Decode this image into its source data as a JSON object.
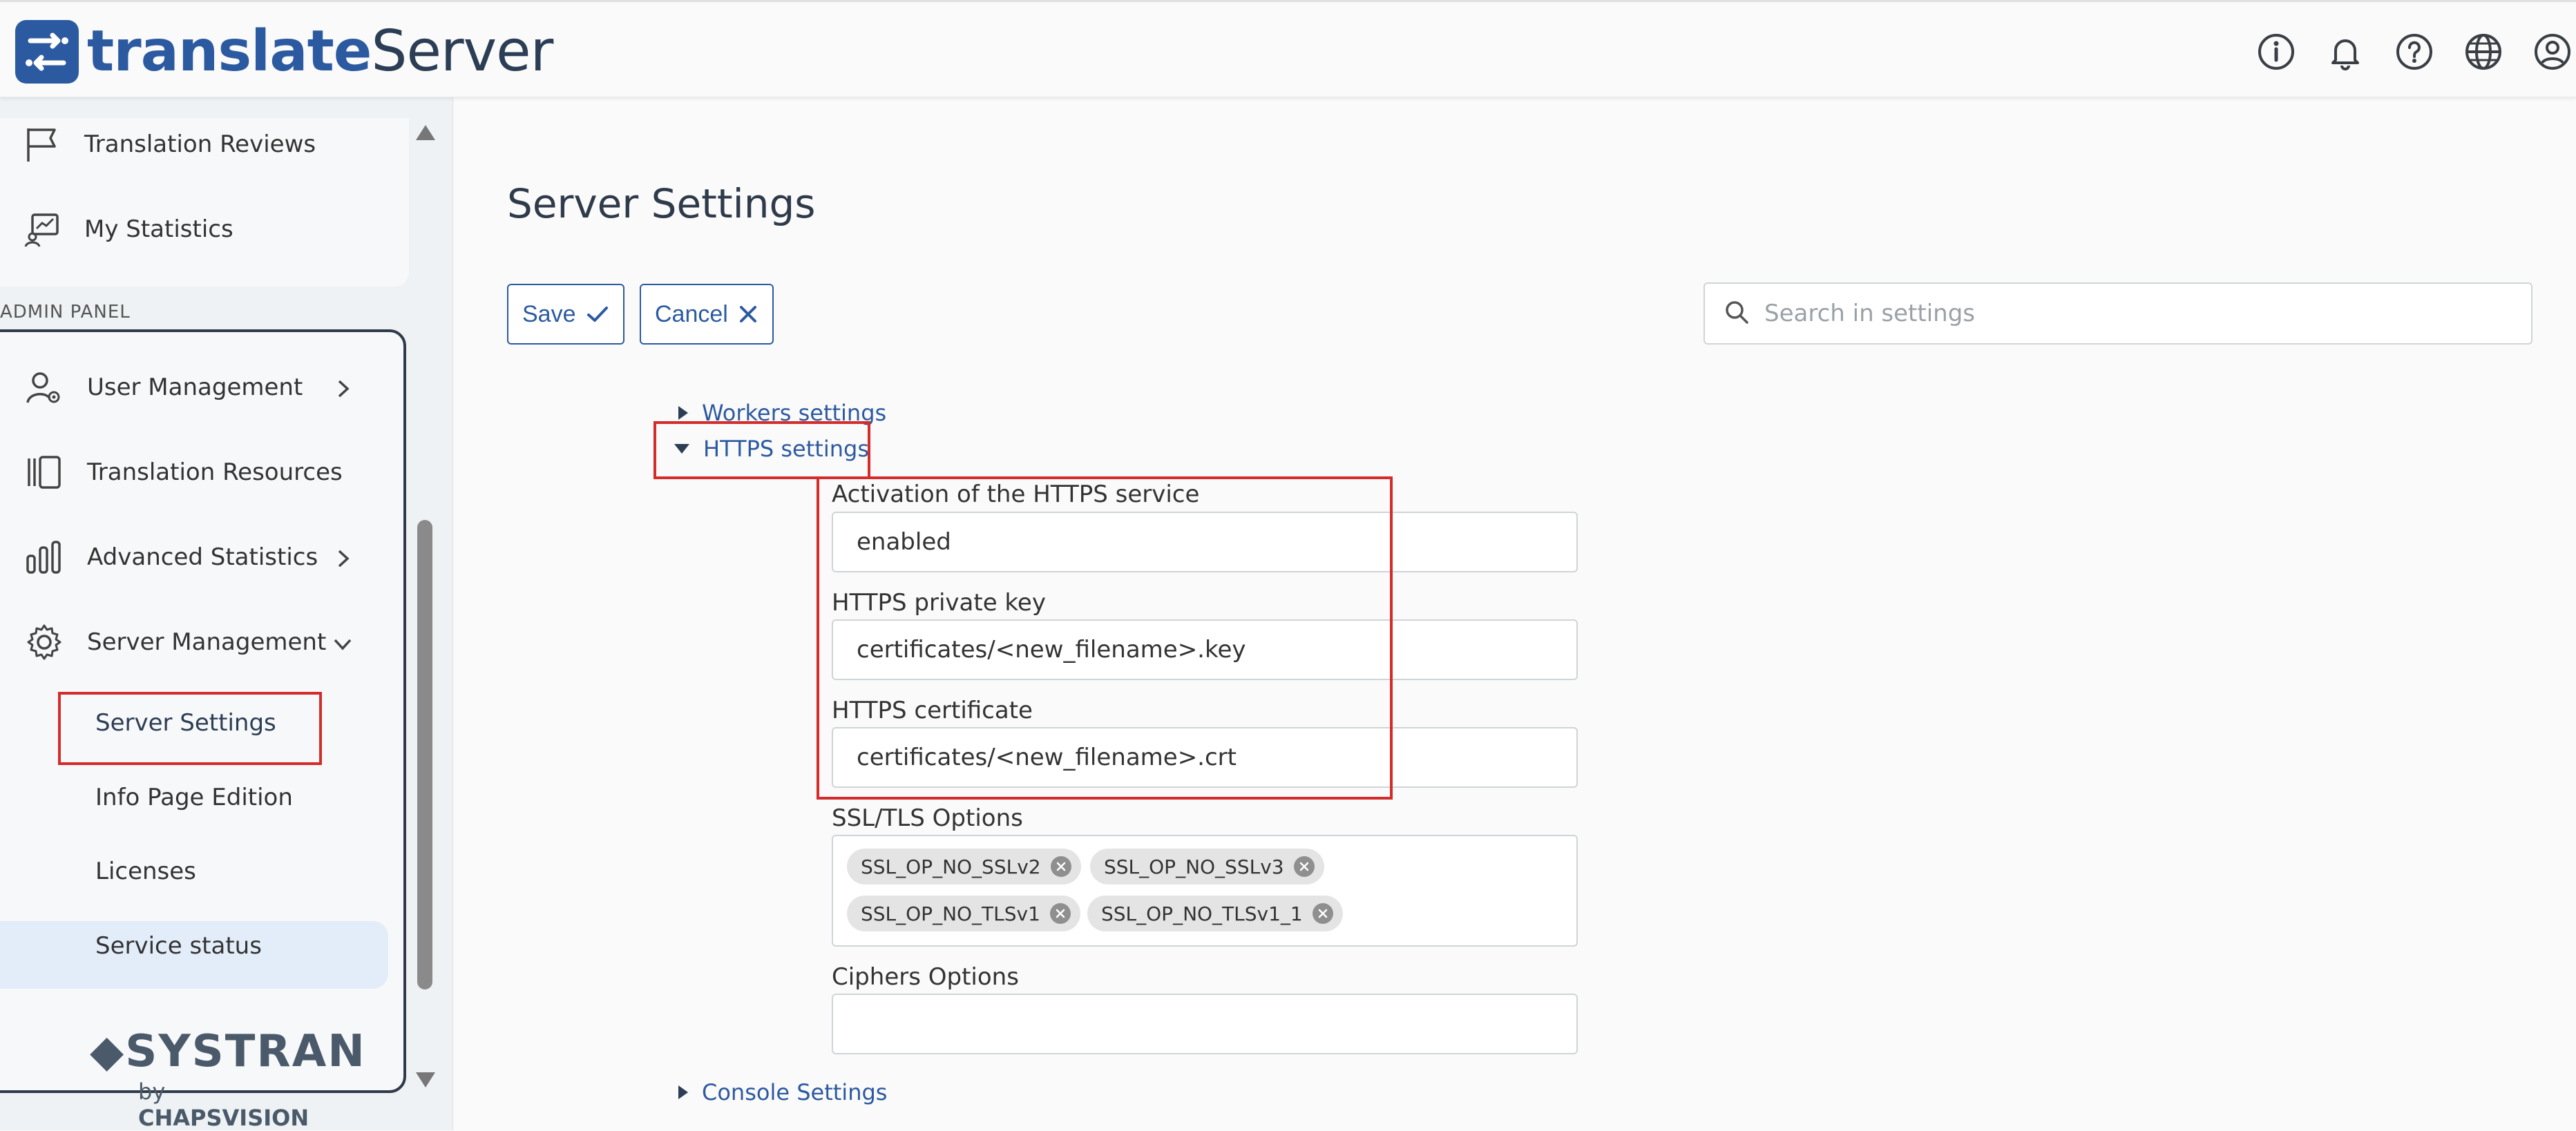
{
  "app": {
    "logo_part1": "translate",
    "logo_part2": "Server"
  },
  "topbar": {
    "icons": [
      "info-icon",
      "bell-icon",
      "help-icon",
      "globe-icon",
      "user-icon"
    ]
  },
  "sidebar": {
    "top_items": [
      {
        "label": "Translation Reviews",
        "icon": "flag-icon"
      },
      {
        "label": "My Statistics",
        "icon": "statistics-icon"
      }
    ],
    "admin_label": "ADMIN PANEL",
    "admin_items": [
      {
        "label": "User Management",
        "icon": "user-gear-icon"
      },
      {
        "label": "Translation Resources",
        "icon": "resources-icon"
      },
      {
        "label": "Advanced Statistics",
        "icon": "bar-chart-icon"
      },
      {
        "label": "Server Management",
        "icon": "gear-icon"
      }
    ],
    "sub_items": [
      "Server Settings",
      "Info Page Edition",
      "Licenses",
      "Service status"
    ],
    "footer": {
      "brand": "SYSTRAN",
      "by": "by",
      "company": "CHAPSVISION"
    }
  },
  "main": {
    "title": "Server Settings",
    "save_label": "Save",
    "cancel_label": "Cancel",
    "search_placeholder": "Search in settings",
    "sections": {
      "workers": "Workers settings",
      "https": "HTTPS settings",
      "console": "Console Settings"
    },
    "fields": {
      "activation_label": "Activation of the HTTPS service",
      "activation_value": "enabled",
      "key_label": "HTTPS private key",
      "key_value": "certificates/<new_filename>.key",
      "cert_label": "HTTPS certificate",
      "cert_value": "certificates/<new_filename>.crt",
      "ssl_label": "SSL/TLS Options",
      "ssl_tags": [
        "SSL_OP_NO_SSLv2",
        "SSL_OP_NO_SSLv3",
        "SSL_OP_NO_TLSv1",
        "SSL_OP_NO_TLSv1_1"
      ],
      "ciphers_label": "Ciphers Options",
      "ciphers_value": ""
    }
  },
  "colors": {
    "brand": "#2c5aa0",
    "highlight": "#d42b2b",
    "active_bg": "#e3edf9"
  }
}
